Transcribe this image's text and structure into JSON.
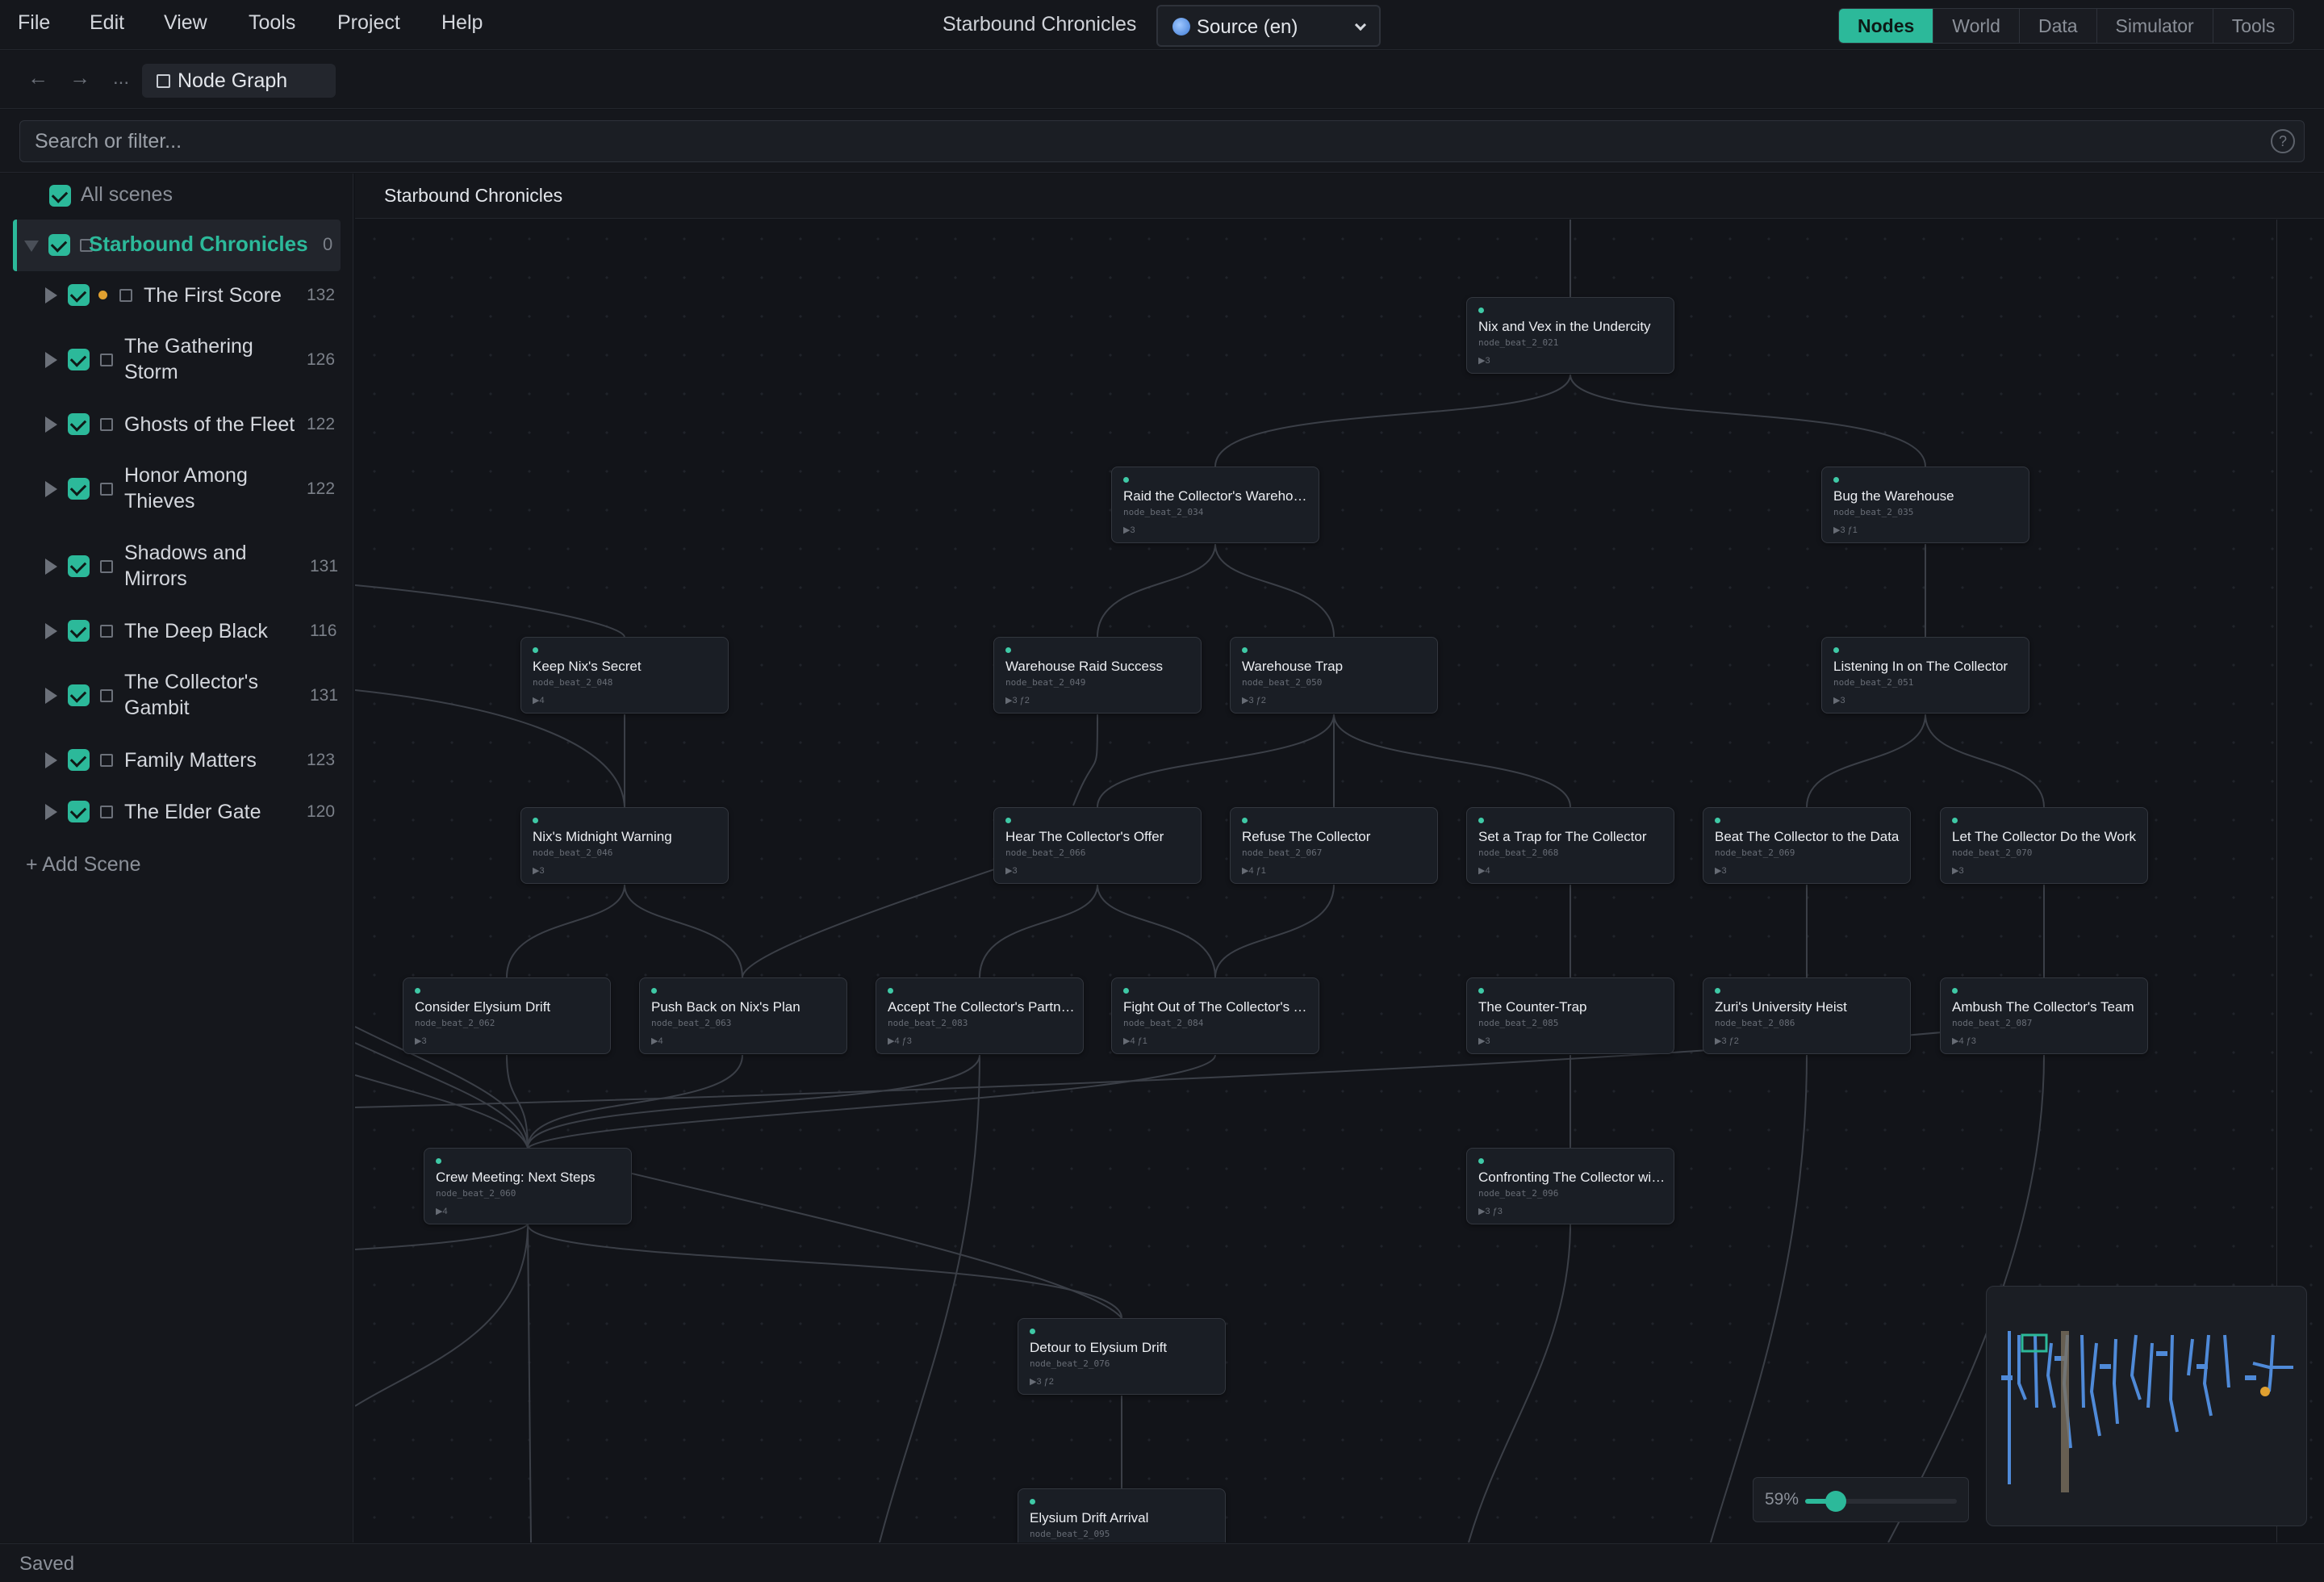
{
  "menu": [
    "File",
    "Edit",
    "View",
    "Tools",
    "Project",
    "Help"
  ],
  "app_title": "Starbound Chronicles",
  "locale": {
    "label": "Source (en)",
    "icon": "globe-icon"
  },
  "mode_tabs": [
    {
      "label": "Nodes",
      "active": true
    },
    {
      "label": "World",
      "active": false
    },
    {
      "label": "Data",
      "active": false
    },
    {
      "label": "Simulator",
      "active": false
    },
    {
      "label": "Tools",
      "active": false
    }
  ],
  "breadcrumb": {
    "back": "←",
    "forward": "→",
    "ellipsis": "...",
    "tab_label": "Node Graph"
  },
  "search": {
    "placeholder": "Search or filter...",
    "help": "?"
  },
  "sidebar": {
    "all_scenes": "All scenes",
    "root": {
      "label": "Starbound Chronicles",
      "count": "0"
    },
    "scenes": [
      {
        "label": "The First Score",
        "count": "132",
        "modified": true
      },
      {
        "label": "The Gathering Storm",
        "count": "126"
      },
      {
        "label": "Ghosts of the Fleet",
        "count": "122"
      },
      {
        "label": "Honor Among Thieves",
        "count": "122"
      },
      {
        "label": "Shadows and Mirrors",
        "count": "131"
      },
      {
        "label": "The Deep Black",
        "count": "116"
      },
      {
        "label": "The Collector's Gambit",
        "count": "131"
      },
      {
        "label": "Family Matters",
        "count": "123"
      },
      {
        "label": "The Elder Gate",
        "count": "120"
      }
    ],
    "add_scene": "+ Add Scene"
  },
  "canvas": {
    "title": "Starbound Chronicles",
    "nodes": [
      {
        "title": "Nix and Vex in the Undercity",
        "id": "node_beat_2_021",
        "meta": "▶3"
      },
      {
        "title": "Raid the Collector's Warehouse",
        "id": "node_beat_2_034",
        "meta": "▶3"
      },
      {
        "title": "Bug the Warehouse",
        "id": "node_beat_2_035",
        "meta": "▶3  ƒ1"
      },
      {
        "title": "Keep Nix's Secret",
        "id": "node_beat_2_048",
        "meta": "▶4"
      },
      {
        "title": "Warehouse Raid Success",
        "id": "node_beat_2_049",
        "meta": "▶3  ƒ2"
      },
      {
        "title": "Warehouse Trap",
        "id": "node_beat_2_050",
        "meta": "▶3  ƒ2"
      },
      {
        "title": "Listening In on The Collector",
        "id": "node_beat_2_051",
        "meta": "▶3"
      },
      {
        "title": "Nix's Midnight Warning",
        "id": "node_beat_2_046",
        "meta": "▶3"
      },
      {
        "title": "Hear The Collector's Offer",
        "id": "node_beat_2_066",
        "meta": "▶3"
      },
      {
        "title": "Refuse The Collector",
        "id": "node_beat_2_067",
        "meta": "▶4  ƒ1"
      },
      {
        "title": "Set a Trap for The Collector",
        "id": "node_beat_2_068",
        "meta": "▶4"
      },
      {
        "title": "Beat The Collector to the Data",
        "id": "node_beat_2_069",
        "meta": "▶3"
      },
      {
        "title": "Let The Collector Do the Work",
        "id": "node_beat_2_070",
        "meta": "▶3"
      },
      {
        "title": "Consider Elysium Drift",
        "id": "node_beat_2_062",
        "meta": "▶3"
      },
      {
        "title": "Push Back on Nix's Plan",
        "id": "node_beat_2_063",
        "meta": "▶4"
      },
      {
        "title": "Accept The Collector's Partnership",
        "id": "node_beat_2_083",
        "meta": "▶4  ƒ3"
      },
      {
        "title": "Fight Out of The Collector's Trap",
        "id": "node_beat_2_084",
        "meta": "▶4  ƒ1"
      },
      {
        "title": "The Counter-Trap",
        "id": "node_beat_2_085",
        "meta": "▶3"
      },
      {
        "title": "Zuri's University Heist",
        "id": "node_beat_2_086",
        "meta": "▶3  ƒ2"
      },
      {
        "title": "Ambush The Collector's Team",
        "id": "node_beat_2_087",
        "meta": "▶4  ƒ3"
      },
      {
        "title": "Crew Meeting: Next Steps",
        "id": "node_beat_2_060",
        "meta": "▶4"
      },
      {
        "title": "Confronting The Collector with Proof",
        "id": "node_beat_2_096",
        "meta": "▶3  ƒ3"
      },
      {
        "title": "Detour to Elysium Drift",
        "id": "node_beat_2_076",
        "meta": "▶3  ƒ2"
      },
      {
        "title": "Elysium Drift Arrival",
        "id": "node_beat_2_095",
        "meta": ""
      }
    ]
  },
  "zoom": {
    "label": "59%",
    "level": 0.2
  },
  "status": "Saved",
  "colors": {
    "accent": "#2cb99a",
    "background": "#121419",
    "panel": "#15171c",
    "modified_dot": "#e0a030"
  }
}
